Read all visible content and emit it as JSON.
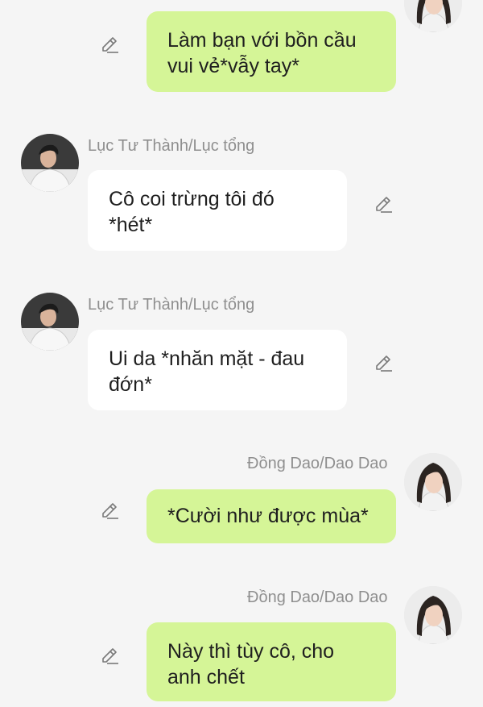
{
  "messages": [
    {
      "side": "right",
      "sender": "",
      "text": "Làm bạn với bồn cầu vui vẻ*vẫy tay*",
      "lines": [
        "Làm bạn với bồn cầu",
        "vui vẻ*vẫy tay*"
      ]
    },
    {
      "side": "left",
      "sender": "Lục Tư Thành/Lục tổng",
      "text": "Cô coi trừng tôi đó *hét*",
      "lines": [
        "Cô coi trừng tôi đó",
        "*hét*"
      ]
    },
    {
      "side": "left",
      "sender": "Lục Tư Thành/Lục tổng",
      "text": "Ui da *nhăn mặt - đau đớn*",
      "lines": [
        "Ui da *nhăn mặt - đau",
        "đớn*"
      ]
    },
    {
      "side": "right",
      "sender": "Đồng Dao/Dao Dao",
      "text": "*Cười như được mùa*",
      "lines": [
        "*Cười như được mùa*"
      ]
    },
    {
      "side": "right",
      "sender": "Đồng Dao/Dao Dao",
      "text": "Này thì tùy cô, cho anh chết",
      "lines": [
        "Này thì tùy cô, cho",
        "anh chết"
      ]
    }
  ],
  "colors": {
    "background": "#f5f5f5",
    "outgoing_bubble": "#d5f597",
    "incoming_bubble": "#ffffff",
    "sender_name": "#8f8f8f",
    "text": "#1f1f1f"
  },
  "icons": {
    "edit": "pencil-edit-icon"
  }
}
